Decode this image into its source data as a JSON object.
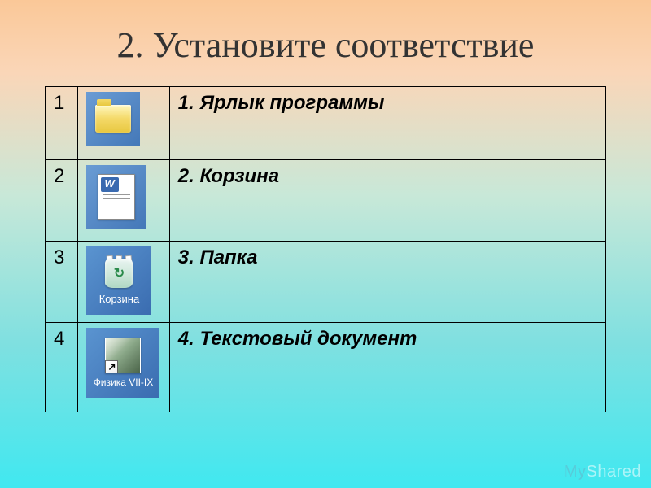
{
  "title": "2. Установите соответствие",
  "rows": [
    {
      "num": "1",
      "icon_caption": "",
      "text": "1. Ярлык программы"
    },
    {
      "num": "2",
      "icon_caption": "",
      "text": "2. Корзина"
    },
    {
      "num": "3",
      "icon_caption": "Корзина",
      "text": "3. Папка"
    },
    {
      "num": "4",
      "icon_caption": "Физика VII-IX",
      "text": "4. Текстовый документ"
    }
  ],
  "shortcut_arrow": "↗",
  "watermark": {
    "my": "My",
    "shared": "Shared"
  }
}
